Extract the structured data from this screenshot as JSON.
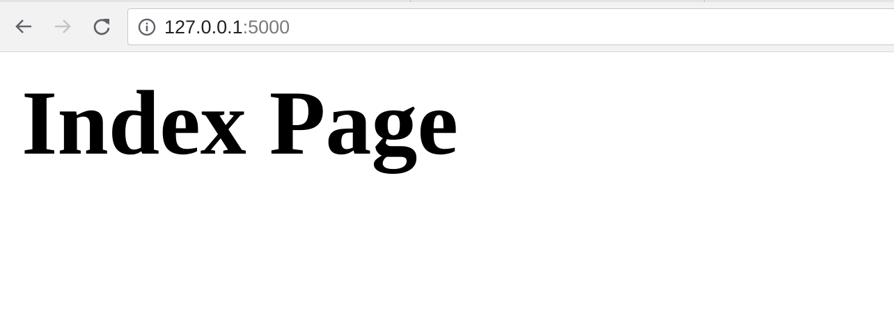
{
  "browser": {
    "nav": {
      "back_icon": "arrow-left-icon",
      "forward_icon": "arrow-right-icon",
      "forward_enabled": false,
      "reload_icon": "reload-icon"
    },
    "address_bar": {
      "info_icon": "info-icon",
      "url_host": "127.0.0.1",
      "url_port": ":5000"
    },
    "colors": {
      "toolbar_bg": "#f2f2f2",
      "icon_active": "#5f6368",
      "icon_disabled": "#c4c4c4",
      "url_host": "#202124",
      "url_port": "#7a7a7a"
    }
  },
  "page": {
    "heading": "Index Page"
  }
}
